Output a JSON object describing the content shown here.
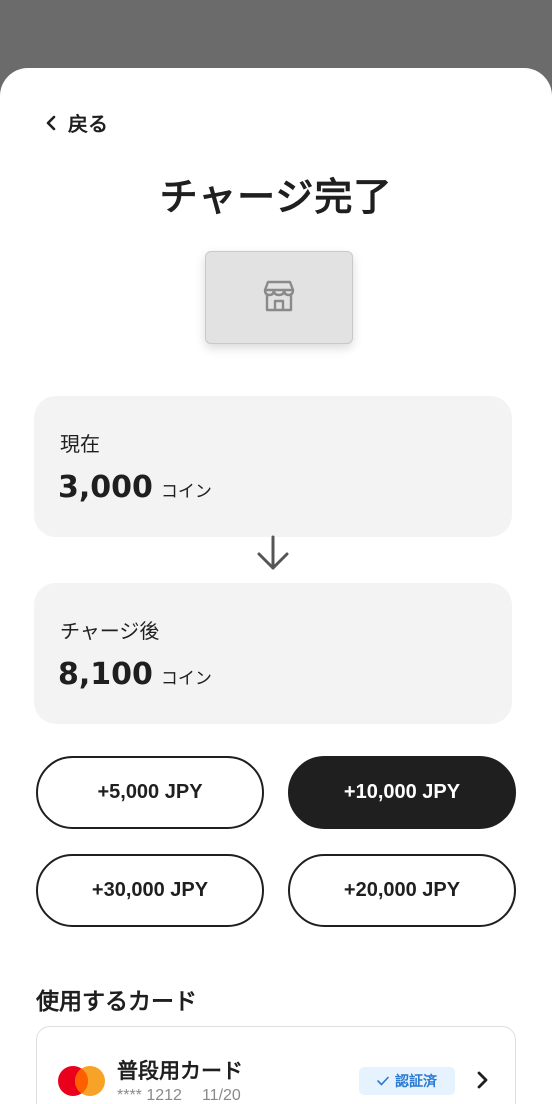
{
  "nav": {
    "back_label": "戻る"
  },
  "page": {
    "title": "チャージ完了"
  },
  "icons": {
    "back": "chevron-left-icon",
    "store": "storefront-icon",
    "arrow": "arrow-down-icon",
    "card_brand": "mastercard-icon",
    "check": "check-icon",
    "chevron": "chevron-right-icon"
  },
  "balance": {
    "current": {
      "label": "現在",
      "amount": "3,000",
      "unit": "コイン"
    },
    "after": {
      "label": "チャージ後",
      "amount": "8,100",
      "unit": "コイン"
    }
  },
  "amount_options": [
    {
      "label": "+5,000 JPY",
      "selected": false
    },
    {
      "label": "+10,000 JPY",
      "selected": true
    },
    {
      "label": "+30,000 JPY",
      "selected": false
    },
    {
      "label": "+20,000 JPY",
      "selected": false
    }
  ],
  "payment": {
    "section_title": "使用するカード",
    "card_name": "普段用カード",
    "card_number": "**** 1212",
    "card_expiry": "11/20",
    "status_badge": "認証済"
  },
  "colors": {
    "backdrop": "#6b6b6b",
    "sheet": "#ffffff",
    "card_bg": "#f3f3f3",
    "selected_button": "#1f1f1f",
    "badge_bg": "#e6f2fd",
    "badge_text": "#2a7ad2",
    "mastercard_red": "#eb001b",
    "mastercard_orange": "#f79e1b"
  }
}
